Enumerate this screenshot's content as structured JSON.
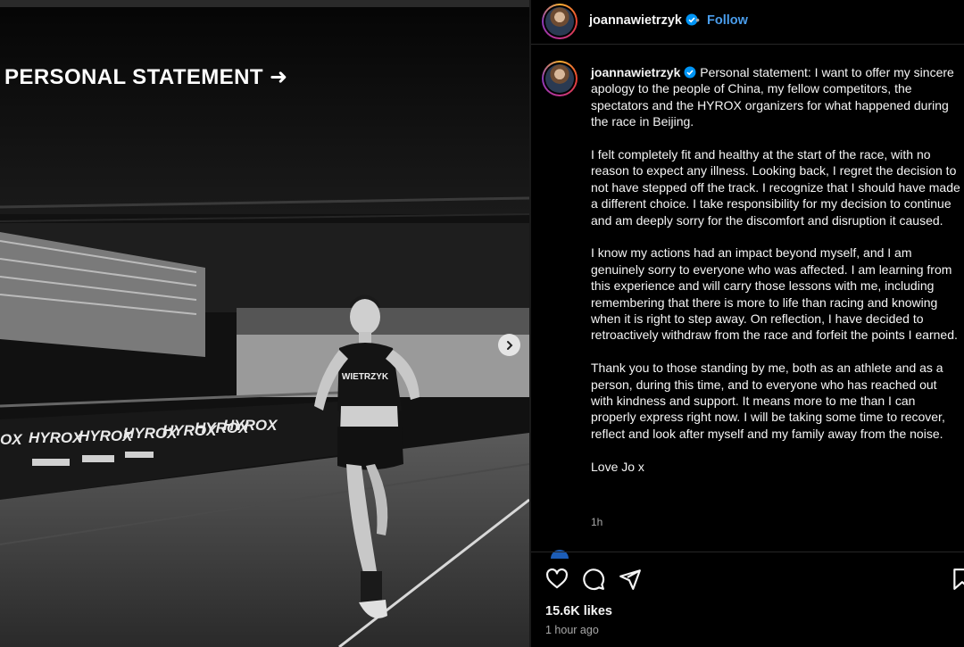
{
  "media": {
    "title": "PERSONAL STATEMENT ➜",
    "photo_alt": "Black and white photo of runner wearing WIETRZYK bib in a HYROX arena",
    "bib_text": "WIETRZYK",
    "banner_text": "HYROX"
  },
  "header": {
    "username": "joannawietrzyk",
    "separator": "•",
    "follow_label": "Follow"
  },
  "caption": {
    "username": "joannawietrzyk",
    "paragraphs": [
      "Personal statement: I want to offer my sincere apology to the people of China, my fellow competitors, the spectators and the HYROX organizers for what happened during the race in Beijing.",
      "I felt completely fit and healthy at the start of the race, with no reason to expect any illness. Looking back, I regret the decision to not have stepped off the track. I recognize that I should have made a different choice. I take responsibility for my decision to continue and am deeply sorry for the discomfort and disruption it caused.",
      "I know my actions had an impact beyond myself, and I am genuinely sorry to everyone who was affected. I am learning from this experience and will carry those lessons with me, including remembering that there is more to life than racing and knowing when it is right to step away. On reflection, I have decided to retroactively withdraw from the race and forfeit the points I earned.",
      "Thank you to those standing by me, both as an athlete and as a person, during this time, and to everyone who has reached out with kindness and support. It means more to me than I can properly express right now. I will be taking some time to recover, reflect and look after myself and my family away from the noise.",
      "Love Jo x"
    ],
    "time": "1h"
  },
  "stats": {
    "likes": "15.6K likes",
    "posted": "1 hour ago"
  },
  "icons": {
    "like": "heart-icon",
    "comment": "comment-icon",
    "share": "share-icon",
    "save": "bookmark-icon",
    "verified": "verified-badge-icon",
    "next": "chevron-right-icon"
  },
  "colors": {
    "accent": "#4a9dec",
    "verified": "#0095f6",
    "muted": "#a8a8a8"
  }
}
